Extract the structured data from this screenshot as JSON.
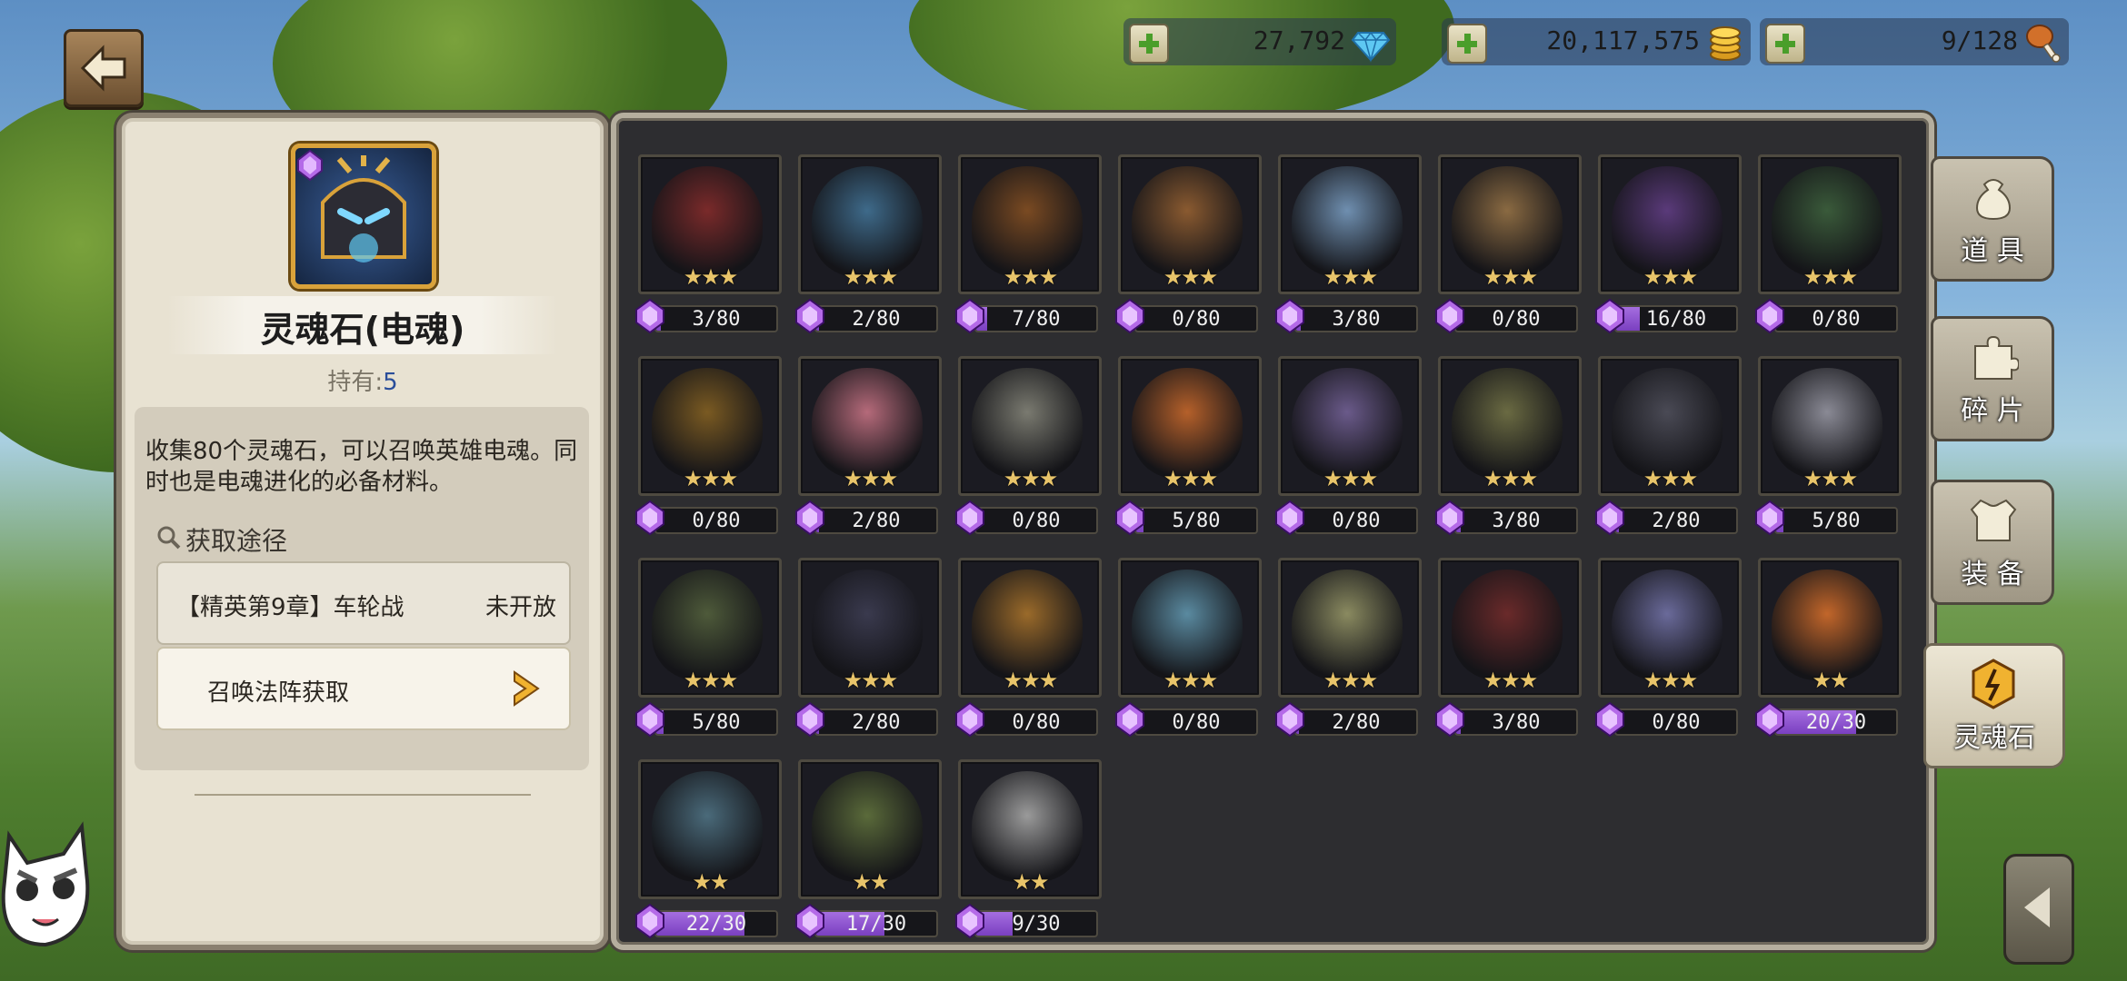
{
  "currency": [
    {
      "value": "27,792",
      "icon": "diamond-icon"
    },
    {
      "value": "20,117,575",
      "icon": "gold-coin-icon"
    },
    {
      "value": "9/128",
      "icon": "drumstick-icon"
    }
  ],
  "item": {
    "name": "灵魂石(电魂)",
    "owned_label": "持有:",
    "owned_value": "5",
    "description": "收集80个灵魂石，可以召唤英雄电魂。同时也是电魂进化的必备材料。",
    "sources_label": "获取途径",
    "sources": [
      {
        "name": "【精英第9章】车轮战",
        "state": "未开放"
      },
      {
        "name": "召唤法阵获取",
        "state": ""
      }
    ]
  },
  "tabs": [
    {
      "label": "道 具",
      "icon": "bag-icon"
    },
    {
      "label": "碎 片",
      "icon": "puzzle-piece-icon"
    },
    {
      "label": "装 备",
      "icon": "armor-icon"
    },
    {
      "label": "灵魂石",
      "icon": "soulstone-icon"
    }
  ],
  "soulstones": [
    {
      "progress": "3/80",
      "have": 3,
      "need": 80,
      "stars": 3,
      "color": "#7a2a2a"
    },
    {
      "progress": "2/80",
      "have": 2,
      "need": 80,
      "stars": 3,
      "color": "#3e6a8a"
    },
    {
      "progress": "7/80",
      "have": 7,
      "need": 80,
      "stars": 3,
      "color": "#7a4a22"
    },
    {
      "progress": "0/80",
      "have": 0,
      "need": 80,
      "stars": 3,
      "color": "#8a5a30"
    },
    {
      "progress": "3/80",
      "have": 3,
      "need": 80,
      "stars": 3,
      "color": "#6f8fb0"
    },
    {
      "progress": "0/80",
      "have": 0,
      "need": 80,
      "stars": 3,
      "color": "#8a6a42"
    },
    {
      "progress": "16/80",
      "have": 16,
      "need": 80,
      "stars": 3,
      "color": "#5a3a7a"
    },
    {
      "progress": "0/80",
      "have": 0,
      "need": 80,
      "stars": 3,
      "color": "#3a5a3a"
    },
    {
      "progress": "0/80",
      "have": 0,
      "need": 80,
      "stars": 3,
      "color": "#7a5a22"
    },
    {
      "progress": "2/80",
      "have": 2,
      "need": 80,
      "stars": 3,
      "color": "#b56a7a"
    },
    {
      "progress": "0/80",
      "have": 0,
      "need": 80,
      "stars": 3,
      "color": "#7a7a70"
    },
    {
      "progress": "5/80",
      "have": 5,
      "need": 80,
      "stars": 3,
      "color": "#b5602a"
    },
    {
      "progress": "0/80",
      "have": 0,
      "need": 80,
      "stars": 3,
      "color": "#6a5a8a"
    },
    {
      "progress": "3/80",
      "have": 3,
      "need": 80,
      "stars": 3,
      "color": "#6a6a42"
    },
    {
      "progress": "2/80",
      "have": 2,
      "need": 80,
      "stars": 3,
      "color": "#4a4a55"
    },
    {
      "progress": "5/80",
      "have": 5,
      "need": 80,
      "stars": 3,
      "color": "#8a8a95"
    },
    {
      "progress": "5/80",
      "have": 5,
      "need": 80,
      "stars": 3,
      "color": "#4e5a3a"
    },
    {
      "progress": "2/80",
      "have": 2,
      "need": 80,
      "stars": 3,
      "color": "#3a3a4e"
    },
    {
      "progress": "0/80",
      "have": 0,
      "need": 80,
      "stars": 3,
      "color": "#9a6a2a"
    },
    {
      "progress": "0/80",
      "have": 0,
      "need": 80,
      "stars": 3,
      "color": "#5a8aa0"
    },
    {
      "progress": "2/80",
      "have": 2,
      "need": 80,
      "stars": 3,
      "color": "#8a8a60"
    },
    {
      "progress": "3/80",
      "have": 3,
      "need": 80,
      "stars": 3,
      "color": "#6a2a2a"
    },
    {
      "progress": "0/80",
      "have": 0,
      "need": 80,
      "stars": 3,
      "color": "#6a6a9a"
    },
    {
      "progress": "20/30",
      "have": 20,
      "need": 30,
      "stars": 2,
      "color": "#c2662a"
    },
    {
      "progress": "22/30",
      "have": 22,
      "need": 30,
      "stars": 2,
      "color": "#4a6a7a"
    },
    {
      "progress": "17/30",
      "have": 17,
      "need": 30,
      "stars": 2,
      "color": "#5a6a3a"
    },
    {
      "progress": "9/30",
      "have": 9,
      "need": 30,
      "stars": 2,
      "color": "#9a9a9a"
    }
  ]
}
